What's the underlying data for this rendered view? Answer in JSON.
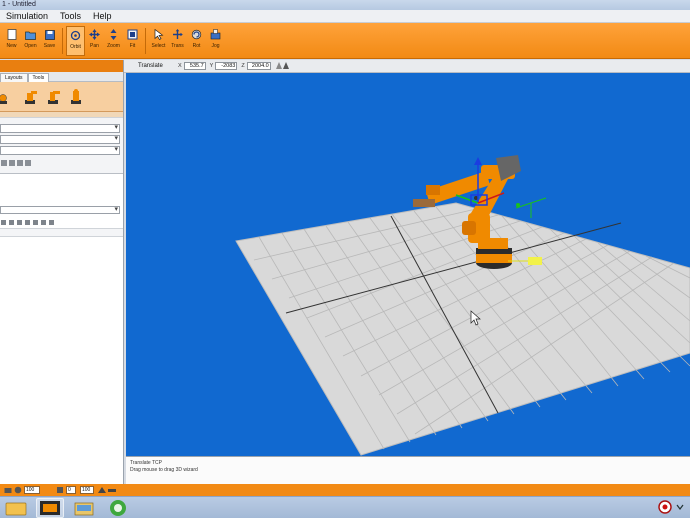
{
  "window": {
    "title": "1 - Untitled"
  },
  "menu": {
    "items": [
      "Simulation",
      "Tools",
      "Help"
    ]
  },
  "toolbar": {
    "buttons": [
      {
        "label": "New",
        "icon": "new-file-icon"
      },
      {
        "label": "Open",
        "icon": "open-folder-icon"
      },
      {
        "label": "Save",
        "icon": "save-icon"
      },
      {
        "label": "Orbit",
        "icon": "orbit-icon"
      },
      {
        "label": "Pan",
        "icon": "pan-icon"
      },
      {
        "label": "Zoom",
        "icon": "zoom-icon"
      },
      {
        "label": "Fit",
        "icon": "fit-icon"
      },
      {
        "label": "Select",
        "icon": "select-arrow-icon"
      },
      {
        "label": "Trans",
        "icon": "translate-icon"
      },
      {
        "label": "Rot",
        "icon": "rotate-icon"
      },
      {
        "label": "Jog",
        "icon": "jog-icon"
      }
    ]
  },
  "left_panel": {
    "tabs": [
      "Layouts",
      "Tools"
    ]
  },
  "viewbar": {
    "label": "Translate",
    "x_label": "X",
    "x_value": "535.7",
    "y_label": "Y",
    "y_value": "-2083",
    "z_label": "Z",
    "z_value": "2004.0"
  },
  "message_panel": {
    "line1": "Translate TCP",
    "line2": "Drag mouse to drag 3D wizard"
  },
  "statusbar": {
    "field1": "100",
    "field2": "0",
    "field3": "100"
  },
  "colors": {
    "accent": "#f28a14",
    "viewport_bg": "#1169d0",
    "robot": "#f08a00"
  }
}
